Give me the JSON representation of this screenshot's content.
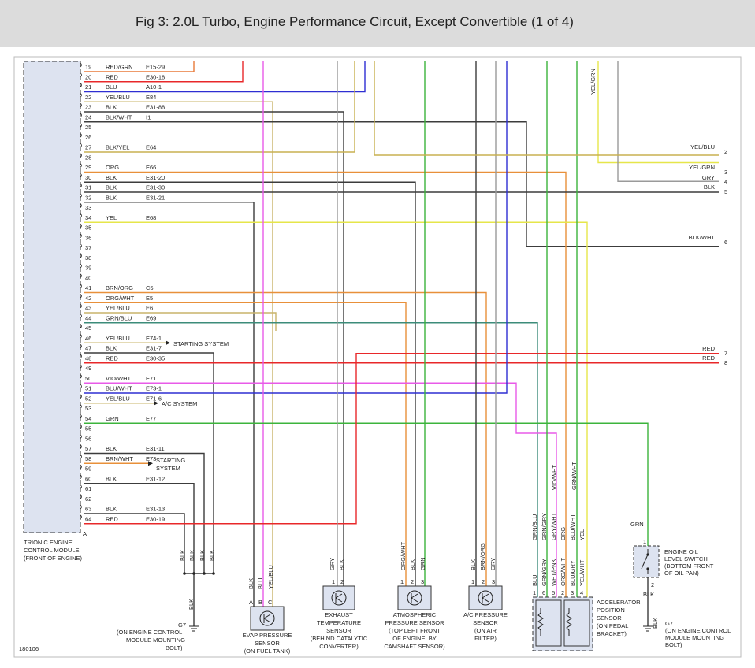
{
  "title": "Fig 3: 2.0L Turbo, Engine Performance Circuit, Except Convertible (1 of 4)",
  "figure_id": "180106",
  "ecm": {
    "label_lines": [
      "TRIONIC ENGINE",
      "CONTROL MODULE",
      "(FRONT OF ENGINE)"
    ],
    "connector_letter": "A"
  },
  "pins": [
    {
      "pin": "19",
      "color": "RED/GRN",
      "ref": "E15-29"
    },
    {
      "pin": "20",
      "color": "RED",
      "ref": "E30-18"
    },
    {
      "pin": "21",
      "color": "BLU",
      "ref": "A10-1"
    },
    {
      "pin": "22",
      "color": "YEL/BLU",
      "ref": "E84"
    },
    {
      "pin": "23",
      "color": "BLK",
      "ref": "E31-88"
    },
    {
      "pin": "24",
      "color": "BLK/WHT",
      "ref": "I1"
    },
    {
      "pin": "25",
      "color": "",
      "ref": ""
    },
    {
      "pin": "26",
      "color": "",
      "ref": ""
    },
    {
      "pin": "27",
      "color": "BLK/YEL",
      "ref": "E64"
    },
    {
      "pin": "28",
      "color": "",
      "ref": ""
    },
    {
      "pin": "29",
      "color": "ORG",
      "ref": "E66"
    },
    {
      "pin": "30",
      "color": "BLK",
      "ref": "E31-20"
    },
    {
      "pin": "31",
      "color": "BLK",
      "ref": "E31-30"
    },
    {
      "pin": "32",
      "color": "BLK",
      "ref": "E31-21"
    },
    {
      "pin": "33",
      "color": "",
      "ref": ""
    },
    {
      "pin": "34",
      "color": "YEL",
      "ref": "E68"
    },
    {
      "pin": "35",
      "color": "",
      "ref": ""
    },
    {
      "pin": "36",
      "color": "",
      "ref": ""
    },
    {
      "pin": "37",
      "color": "",
      "ref": ""
    },
    {
      "pin": "38",
      "color": "",
      "ref": ""
    },
    {
      "pin": "39",
      "color": "",
      "ref": ""
    },
    {
      "pin": "40",
      "color": "",
      "ref": ""
    },
    {
      "pin": "41",
      "color": "BRN/ORG",
      "ref": "C5"
    },
    {
      "pin": "42",
      "color": "ORG/WHT",
      "ref": "E5"
    },
    {
      "pin": "43",
      "color": "YEL/BLU",
      "ref": "E6"
    },
    {
      "pin": "44",
      "color": "GRN/BLU",
      "ref": "E69"
    },
    {
      "pin": "45",
      "color": "",
      "ref": ""
    },
    {
      "pin": "46",
      "color": "YEL/BLU",
      "ref": "E74-1"
    },
    {
      "pin": "47",
      "color": "BLK",
      "ref": "E31-7"
    },
    {
      "pin": "48",
      "color": "RED",
      "ref": "E30-35"
    },
    {
      "pin": "49",
      "color": "",
      "ref": ""
    },
    {
      "pin": "50",
      "color": "VIO/WHT",
      "ref": "E71"
    },
    {
      "pin": "51",
      "color": "BLU/WHT",
      "ref": "E73-1"
    },
    {
      "pin": "52",
      "color": "YEL/BLU",
      "ref": "E71-6"
    },
    {
      "pin": "53",
      "color": "",
      "ref": ""
    },
    {
      "pin": "54",
      "color": "GRN",
      "ref": "E77"
    },
    {
      "pin": "55",
      "color": "",
      "ref": ""
    },
    {
      "pin": "56",
      "color": "",
      "ref": ""
    },
    {
      "pin": "57",
      "color": "BLK",
      "ref": "E31-11"
    },
    {
      "pin": "58",
      "color": "BRN/WHT",
      "ref": "E73"
    },
    {
      "pin": "59",
      "color": "",
      "ref": ""
    },
    {
      "pin": "60",
      "color": "BLK",
      "ref": "E31-12"
    },
    {
      "pin": "61",
      "color": "",
      "ref": ""
    },
    {
      "pin": "62",
      "color": "",
      "ref": ""
    },
    {
      "pin": "63",
      "color": "BLK",
      "ref": "E31-13"
    },
    {
      "pin": "64",
      "color": "RED",
      "ref": "E30-19"
    }
  ],
  "system_arrows": [
    {
      "pin": "46",
      "lines": [
        "STARTING SYSTEM"
      ]
    },
    {
      "pin": "52",
      "lines": [
        "A/C SYSTEM"
      ]
    },
    {
      "pin": "58",
      "lines": [
        "STARTING",
        "SYSTEM"
      ]
    }
  ],
  "right_connections": [
    {
      "color": "YEL/BLU",
      "num": "2"
    },
    {
      "color": "YEL/GRN",
      "num": "3"
    },
    {
      "color": "GRY",
      "num": "4"
    },
    {
      "color": "BLK",
      "num": "5"
    },
    {
      "color": "BLK/WHT",
      "num": "6"
    },
    {
      "color": "RED",
      "num": "7"
    },
    {
      "color": "RED",
      "num": "8"
    }
  ],
  "top_right_wire_label": "YEL/GRN",
  "ground_left": {
    "wire_labels": [
      "BLK",
      "BLK",
      "BLK",
      "BLK"
    ],
    "ground_wire": "BLK",
    "id": "G7",
    "desc": [
      "(ON ENGINE CONTROL",
      "MODULE MOUNTING",
      "BOLT)"
    ]
  },
  "components": {
    "evap": {
      "pins": [
        "A",
        "B",
        "C"
      ],
      "wires": [
        "BLK",
        "BLU",
        "YEL/BLU"
      ],
      "label": [
        "EVAP PRESSURE",
        "SENSOR",
        "(ON FUEL TANK)"
      ]
    },
    "exhaust": {
      "pins": [
        "1",
        "2"
      ],
      "wires": [
        "GRY",
        "BLK"
      ],
      "label": [
        "EXHAUST",
        "TEMPERATURE",
        "SENSOR",
        "(BEHIND CATALYTIC",
        "CONVERTER)"
      ]
    },
    "atmospheric": {
      "pins": [
        "1",
        "2",
        "3"
      ],
      "wires": [
        "ORG/WHT",
        "BLK",
        "GRN"
      ],
      "label": [
        "ATMOSPHERIC",
        "PRESSURE SENSOR",
        "(TOP LEFT FRONT",
        "OF ENGINE, BY",
        "CAMSHAFT SENSOR)"
      ]
    },
    "ac_pressure": {
      "pins": [
        "1",
        "2",
        "3"
      ],
      "wires": [
        "BLK",
        "BRN/ORG",
        "GRY"
      ],
      "label": [
        "A/C PRESSURE",
        "SENSOR",
        "(ON AIR",
        "FILTER)"
      ]
    },
    "accelerator": {
      "pins": [
        "1",
        "6",
        "5",
        "2",
        "3",
        "4"
      ],
      "wires": [
        "BLU",
        "GRN/GRY",
        "WHT/PNK",
        "ORG/WHT",
        "BLU/GRY",
        "YEL/WHT"
      ],
      "upper_wires": [
        "GRN/BLU",
        "GRN/GRY",
        "GRY/WHT",
        "ORG",
        "BLU/WHT",
        "YEL"
      ],
      "mid_wires": [
        "VIO/WHT",
        "GRN/WHT"
      ],
      "label": [
        "ACCELERATOR",
        "POSITION",
        "SENSOR",
        "(ON PEDAL",
        "BRACKET)"
      ]
    },
    "oil_level": {
      "top_wire": "GRN",
      "pins": [
        "1",
        "2"
      ],
      "bottom_wire": "BLK",
      "label": [
        "ENGINE OIL",
        "LEVEL SWITCH",
        "(BOTTOM FRONT",
        "OF OIL PAN)"
      ],
      "ground_wire": "BLK",
      "ground_id": "G7",
      "ground_desc": [
        "(ON ENGINE CONTROL",
        "MODULE MOUNTING",
        "BOLT)"
      ]
    }
  },
  "wire_colors": {
    "red": "#e8282a",
    "blue": "#2e2ed2",
    "black": "#3c3c3c",
    "gray": "#9a9a9a",
    "yellow": "#e6e64a",
    "yelblu": "#c9b46a",
    "orange": "#e8903a",
    "green": "#3cb43c",
    "violet": "#e85ae8",
    "blkyel": "#c8b050",
    "grnblu": "#3c8c7a",
    "redgrn": "#e87a3a"
  }
}
